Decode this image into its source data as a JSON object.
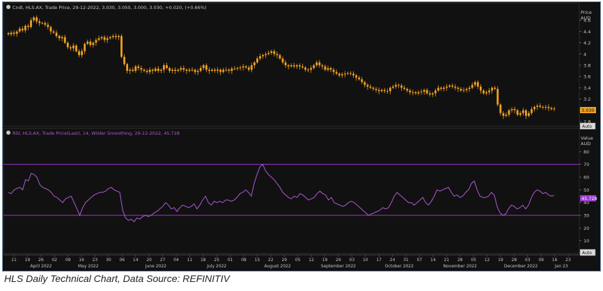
{
  "caption": "HLS Daily Technical Chart, Data Source: REFINITIV",
  "colors": {
    "background": "#111111",
    "candle": "#f0a020",
    "rsi_line": "#b05ad8",
    "rsi_band": "#9b3ad0",
    "text": "#c8c8c8",
    "grid": "#2a2a2a"
  },
  "price_panel": {
    "legend": "Cndl, HLS.AX, Trade Price, 29-12-2022, 3.030, 3.050, 3.000, 3.030, +0.020, (+0.66%)",
    "axis_title": "Price",
    "axis_unit": "AUD",
    "current_value_label": "3.030",
    "auto_label": "Auto"
  },
  "rsi_panel": {
    "legend": "RSI, HLS.AX, Trade Price(Last), 14, Wilder Smoothing, 29-12-2022, 45.728",
    "axis_title": "Value",
    "axis_unit": "AUD",
    "current_value_label": "45.728",
    "auto_label": "Auto"
  },
  "date_axis": {
    "day_ticks": [
      "11",
      "19",
      "26",
      "02",
      "09",
      "16",
      "23",
      "30",
      "06",
      "14",
      "20",
      "27",
      "04",
      "11",
      "18",
      "25",
      "01",
      "08",
      "15",
      "22",
      "29",
      "05",
      "12",
      "19",
      "26",
      "03",
      "10",
      "17",
      "24",
      "31",
      "07",
      "14",
      "21",
      "28",
      "05",
      "12",
      "19",
      "28",
      "03",
      "09",
      "16",
      "23"
    ],
    "months": [
      "April 2022",
      "May 2022",
      "June 2022",
      "July 2022",
      "August 2022",
      "September 2022",
      "October 2022",
      "November 2022",
      "December 2022",
      "Jan 23"
    ]
  },
  "chart_data": [
    {
      "type": "candlestick",
      "title": "Cndl, HLS.AX, Trade Price",
      "ylabel": "Price AUD",
      "ylim": [
        2.75,
        4.75
      ],
      "yticks": [
        2.8,
        3,
        3.2,
        3.4,
        3.6,
        3.8,
        4,
        4.2,
        4.4,
        4.6
      ],
      "grid": false,
      "close": [
        4.35,
        4.38,
        4.36,
        4.4,
        4.45,
        4.42,
        4.5,
        4.48,
        4.6,
        4.65,
        4.58,
        4.55,
        4.55,
        4.52,
        4.48,
        4.4,
        4.38,
        4.32,
        4.28,
        4.3,
        4.2,
        4.12,
        4.1,
        4.15,
        4.05,
        3.98,
        4.05,
        4.18,
        4.22,
        4.16,
        4.2,
        4.25,
        4.28,
        4.3,
        4.25,
        4.28,
        4.3,
        4.32,
        4.3,
        4.32,
        3.95,
        3.82,
        3.7,
        3.72,
        3.7,
        3.78,
        3.75,
        3.72,
        3.7,
        3.68,
        3.72,
        3.7,
        3.74,
        3.7,
        3.72,
        3.8,
        3.75,
        3.7,
        3.72,
        3.7,
        3.72,
        3.75,
        3.72,
        3.7,
        3.72,
        3.72,
        3.68,
        3.7,
        3.75,
        3.8,
        3.72,
        3.7,
        3.72,
        3.7,
        3.72,
        3.68,
        3.72,
        3.72,
        3.7,
        3.74,
        3.74,
        3.75,
        3.76,
        3.78,
        3.76,
        3.72,
        3.8,
        3.85,
        3.92,
        3.96,
        3.98,
        4.0,
        4.02,
        4.05,
        4.0,
        3.98,
        3.92,
        3.85,
        3.8,
        3.78,
        3.8,
        3.78,
        3.8,
        3.78,
        3.76,
        3.72,
        3.72,
        3.75,
        3.8,
        3.85,
        3.8,
        3.78,
        3.72,
        3.75,
        3.72,
        3.68,
        3.65,
        3.62,
        3.64,
        3.65,
        3.66,
        3.65,
        3.62,
        3.58,
        3.55,
        3.5,
        3.45,
        3.42,
        3.4,
        3.38,
        3.36,
        3.34,
        3.36,
        3.34,
        3.34,
        3.4,
        3.42,
        3.45,
        3.44,
        3.4,
        3.38,
        3.35,
        3.32,
        3.32,
        3.3,
        3.32,
        3.33,
        3.36,
        3.3,
        3.28,
        3.3,
        3.35,
        3.4,
        3.38,
        3.4,
        3.42,
        3.44,
        3.42,
        3.4,
        3.38,
        3.35,
        3.36,
        3.38,
        3.4,
        3.45,
        3.5,
        3.42,
        3.35,
        3.3,
        3.32,
        3.35,
        3.4,
        3.38,
        3.1,
        2.95,
        2.9,
        2.92,
        3.0,
        3.02,
        3.0,
        2.92,
        2.95,
        3.0,
        2.9,
        2.95,
        3.02,
        3.06,
        3.08,
        3.06,
        3.05,
        3.06,
        3.04,
        3.02,
        3.03
      ],
      "last_close": 3.03
    },
    {
      "type": "line",
      "title": "RSI, HLS.AX, Trade Price(Last), 14, Wilder Smoothing",
      "ylabel": "Value AUD",
      "ylim": [
        0,
        90
      ],
      "yticks": [
        0,
        10,
        20,
        30,
        40,
        50,
        60,
        70,
        80
      ],
      "bands": [
        30,
        70
      ],
      "grid": false,
      "series": [
        {
          "values": [
            48,
            47,
            50,
            51,
            52,
            50,
            58,
            57,
            63,
            62,
            60,
            54,
            52,
            51,
            50,
            48,
            45,
            44,
            42,
            40,
            43,
            44,
            45,
            40,
            35,
            30,
            36,
            40,
            42,
            44,
            46,
            47,
            48,
            48,
            49,
            51,
            52,
            50,
            49,
            48,
            34,
            28,
            26,
            27,
            25,
            28,
            27,
            29,
            30,
            29,
            30,
            32,
            33,
            35,
            37,
            40,
            38,
            35,
            36,
            33,
            36,
            38,
            37,
            36,
            37,
            39,
            35,
            38,
            42,
            45,
            40,
            38,
            41,
            40,
            41,
            40,
            42,
            42,
            41,
            42,
            44,
            47,
            48,
            50,
            48,
            45,
            55,
            62,
            68,
            70,
            65,
            62,
            60,
            58,
            55,
            52,
            48,
            46,
            44,
            43,
            45,
            44,
            47,
            46,
            44,
            42,
            43,
            44,
            47,
            49,
            47,
            46,
            42,
            44,
            40,
            39,
            38,
            37,
            38,
            40,
            41,
            40,
            38,
            36,
            34,
            32,
            30,
            31,
            32,
            33,
            34,
            36,
            35,
            36,
            40,
            45,
            48,
            46,
            44,
            42,
            40,
            40,
            38,
            40,
            42,
            44,
            40,
            38,
            41,
            45,
            50,
            49,
            50,
            51,
            52,
            48,
            45,
            46,
            44,
            45,
            48,
            50,
            55,
            57,
            50,
            45,
            44,
            44,
            45,
            48,
            46,
            37,
            32,
            30,
            31,
            35,
            38,
            37,
            35,
            36,
            38,
            35,
            38,
            44,
            48,
            50,
            49,
            47,
            48,
            46,
            45,
            45.728
          ]
        }
      ],
      "last_value": 45.728
    }
  ]
}
